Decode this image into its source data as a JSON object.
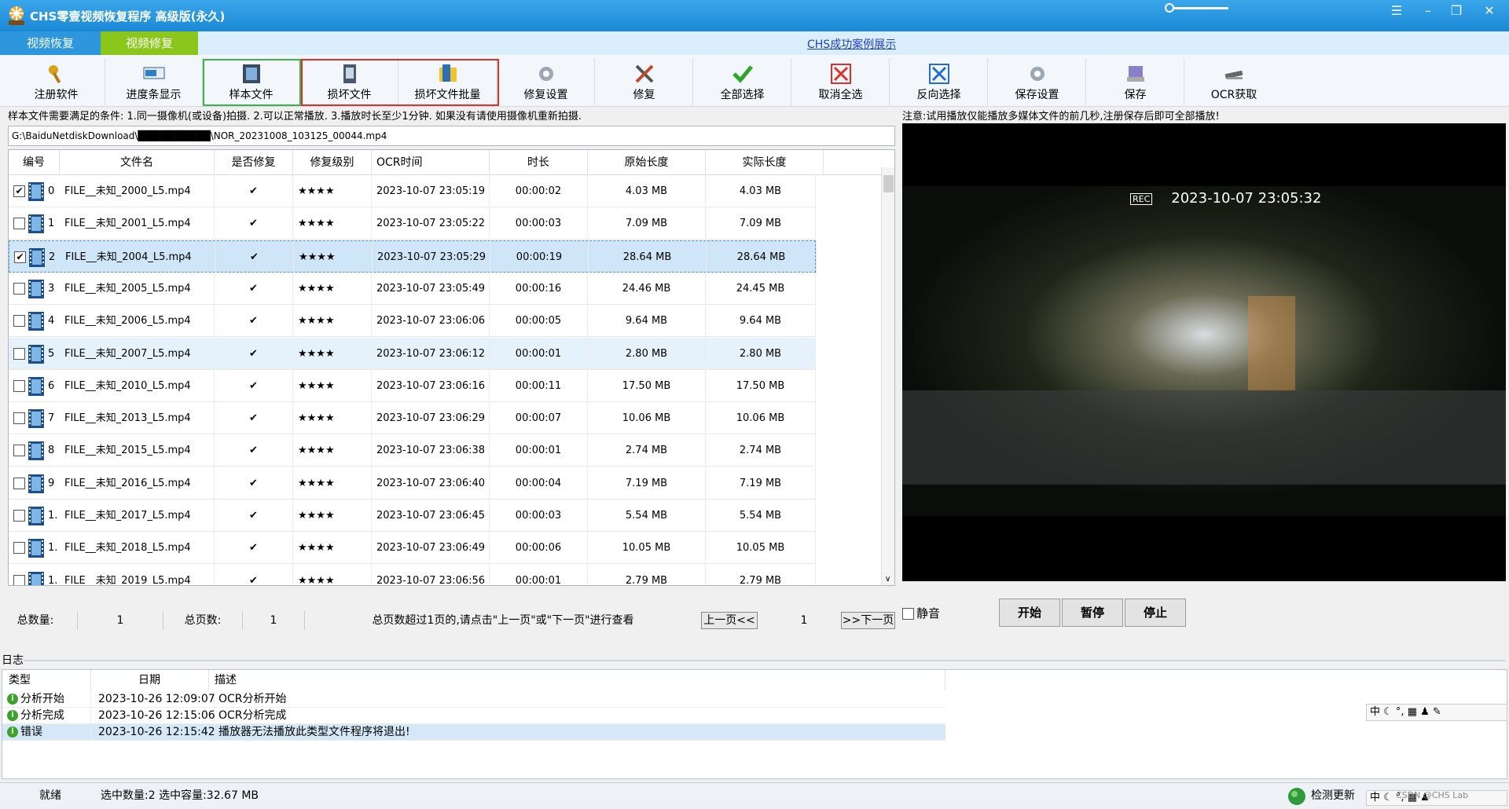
{
  "window": {
    "title": "CHS零壹视频恢复程序 高级版(永久)",
    "controls": [
      "☰",
      "–",
      "❐",
      "✕"
    ]
  },
  "tabs": [
    {
      "label": "视频恢复"
    },
    {
      "label": "视频修复"
    }
  ],
  "case_link": "CHS成功案例展示",
  "toolbar": [
    {
      "label": "注册软件",
      "icon": "key-icon"
    },
    {
      "label": "进度条显示",
      "icon": "progress-icon"
    },
    {
      "label": "样本文件",
      "icon": "film-icon"
    },
    {
      "label": "损坏文件",
      "icon": "file-icon"
    },
    {
      "label": "损坏文件批量",
      "icon": "folder-icon"
    },
    {
      "label": "修复设置",
      "icon": "gear-icon"
    },
    {
      "label": "修复",
      "icon": "tools-icon"
    },
    {
      "label": "全部选择",
      "icon": "check-icon"
    },
    {
      "label": "取消全选",
      "icon": "red-x-icon"
    },
    {
      "label": "反向选择",
      "icon": "blue-x-icon"
    },
    {
      "label": "保存设置",
      "icon": "gear-icon"
    },
    {
      "label": "保存",
      "icon": "disk-icon"
    },
    {
      "label": "OCR获取",
      "icon": "ocr-icon"
    }
  ],
  "notice": "样本文件需要满足的条件: 1.同一摄像机(或设备)拍摄. 2.可以正常播放. 3.播放时长至少1分钟. 如果没有请使用摄像机重新拍摄.",
  "path": "G:\\BaiduNetdiskDownload\\██████████\\NOR_20231008_103125_00044.mp4",
  "table": {
    "headers": [
      "编号",
      "文件名",
      "是否修复",
      "修复级别",
      "OCR时间",
      "时长",
      "原始长度",
      "实际长度"
    ],
    "rows": [
      {
        "idx": "0",
        "name": "FILE__未知_2000_L5.mp4",
        "fixed": "✔",
        "level": "★★★★",
        "ocr": "2023-10-07 23:05:19",
        "dur": "00:00:02",
        "orig": "4.03 MB",
        "real": "4.03 MB",
        "checked": true
      },
      {
        "idx": "1",
        "name": "FILE__未知_2001_L5.mp4",
        "fixed": "✔",
        "level": "★★★★",
        "ocr": "2023-10-07 23:05:22",
        "dur": "00:00:03",
        "orig": "7.09 MB",
        "real": "7.09 MB",
        "checked": false
      },
      {
        "idx": "2",
        "name": "FILE__未知_2004_L5.mp4",
        "fixed": "✔",
        "level": "★★★★",
        "ocr": "2023-10-07 23:05:29",
        "dur": "00:00:19",
        "orig": "28.64 MB",
        "real": "28.64 MB",
        "checked": true
      },
      {
        "idx": "3",
        "name": "FILE__未知_2005_L5.mp4",
        "fixed": "✔",
        "level": "★★★★",
        "ocr": "2023-10-07 23:05:49",
        "dur": "00:00:16",
        "orig": "24.46 MB",
        "real": "24.45 MB",
        "checked": false
      },
      {
        "idx": "4",
        "name": "FILE__未知_2006_L5.mp4",
        "fixed": "✔",
        "level": "★★★★",
        "ocr": "2023-10-07 23:06:06",
        "dur": "00:00:05",
        "orig": "9.64 MB",
        "real": "9.64 MB",
        "checked": false
      },
      {
        "idx": "5",
        "name": "FILE__未知_2007_L5.mp4",
        "fixed": "✔",
        "level": "★★★★",
        "ocr": "2023-10-07 23:06:12",
        "dur": "00:00:01",
        "orig": "2.80 MB",
        "real": "2.80 MB",
        "checked": false
      },
      {
        "idx": "6",
        "name": "FILE__未知_2010_L5.mp4",
        "fixed": "✔",
        "level": "★★★★",
        "ocr": "2023-10-07 23:06:16",
        "dur": "00:00:11",
        "orig": "17.50 MB",
        "real": "17.50 MB",
        "checked": false
      },
      {
        "idx": "7",
        "name": "FILE__未知_2013_L5.mp4",
        "fixed": "✔",
        "level": "★★★★",
        "ocr": "2023-10-07 23:06:29",
        "dur": "00:00:07",
        "orig": "10.06 MB",
        "real": "10.06 MB",
        "checked": false
      },
      {
        "idx": "8",
        "name": "FILE__未知_2015_L5.mp4",
        "fixed": "✔",
        "level": "★★★★",
        "ocr": "2023-10-07 23:06:38",
        "dur": "00:00:01",
        "orig": "2.74 MB",
        "real": "2.74 MB",
        "checked": false
      },
      {
        "idx": "9",
        "name": "FILE__未知_2016_L5.mp4",
        "fixed": "✔",
        "level": "★★★★",
        "ocr": "2023-10-07 23:06:40",
        "dur": "00:00:04",
        "orig": "7.19 MB",
        "real": "7.19 MB",
        "checked": false
      },
      {
        "idx": "1.",
        "name": "FILE__未知_2017_L5.mp4",
        "fixed": "✔",
        "level": "★★★★",
        "ocr": "2023-10-07 23:06:45",
        "dur": "00:00:03",
        "orig": "5.54 MB",
        "real": "5.54 MB",
        "checked": false
      },
      {
        "idx": "1.",
        "name": "FILE__未知_2018_L5.mp4",
        "fixed": "✔",
        "level": "★★★★",
        "ocr": "2023-10-07 23:06:49",
        "dur": "00:00:06",
        "orig": "10.05 MB",
        "real": "10.05 MB",
        "checked": false
      },
      {
        "idx": "1.",
        "name": "FILE__未知_2019_L5.mp4",
        "fixed": "✔",
        "level": "★★★★",
        "ocr": "2023-10-07 23:06:56",
        "dur": "00:00:01",
        "orig": "2.79 MB",
        "real": "2.79 MB",
        "checked": false
      }
    ]
  },
  "pager": {
    "total_label": "总数量:",
    "total_value": "1",
    "pages_label": "总页数:",
    "pages_value": "1",
    "hint": "总页数超过1页的,请点击\"上一页\"或\"下一页\"进行查看",
    "prev": "上一页<<",
    "current": "1",
    "next": ">>下一页"
  },
  "video": {
    "note": "注意:试用播放仅能播放多媒体文件的前几秒,注册保存后即可全部播放!",
    "osd_rec": "REC",
    "osd_time": "2023-10-07 23:05:32",
    "mute_label": "静音",
    "start": "开始",
    "pause": "暂停",
    "stop": "停止"
  },
  "log": {
    "label": "日志",
    "headers": [
      "类型",
      "日期",
      "描述"
    ],
    "rows": [
      {
        "type": "分析开始",
        "date": "2023-10-26 12:09:07",
        "desc": "OCR分析开始"
      },
      {
        "type": "分析完成",
        "date": "2023-10-26 12:15:06",
        "desc": "OCR分析完成"
      },
      {
        "type": "错误",
        "date": "2023-10-26 12:15:42",
        "desc": "播放器无法播放此类型文件程序将退出!"
      }
    ]
  },
  "status": {
    "ready": "就绪",
    "selection": "选中数量:2 选中容量:32.67 MB",
    "update": "检测更新"
  },
  "ime": "中",
  "watermark": "CSDN @CHS Lab"
}
